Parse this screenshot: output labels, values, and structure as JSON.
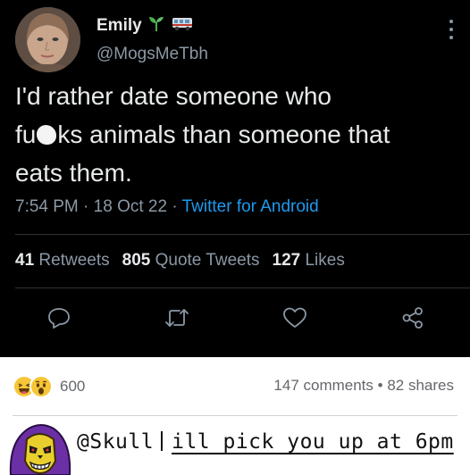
{
  "tweet": {
    "display_name": "Emily",
    "handle": "@MogsMeTbh",
    "text_line1": "I'd rather date someone who",
    "text_line2_pre": "fu",
    "text_line2_post": "ks animals than someone that",
    "text_line3": "eats them.",
    "time": "7:54 PM",
    "date": "18 Oct 22",
    "source": "Twitter for Android",
    "retweets_count": "41",
    "retweets_label": "Retweets",
    "quotes_count": "805",
    "quotes_label": "Quote Tweets",
    "likes_count": "127",
    "likes_label": "Likes",
    "icons": [
      "sprout-icon",
      "van-icon",
      "more-icon",
      "reply-icon",
      "retweet-icon",
      "like-icon",
      "share-icon"
    ]
  },
  "post": {
    "reaction_count": "600",
    "comments_label": "147 comments",
    "shares_label": "82 shares",
    "comment_mention": "@Skull",
    "comment_text": "ill pick you up at 6pm",
    "icons": [
      "laughing-emoji-icon",
      "wow-emoji-icon",
      "skeletor-avatar-icon"
    ]
  },
  "colors": {
    "tweet_bg": "#000000",
    "text": "#e7e9ea",
    "muted": "#8b98a5",
    "link": "#1d9bf0",
    "fb_muted": "#65676b"
  }
}
